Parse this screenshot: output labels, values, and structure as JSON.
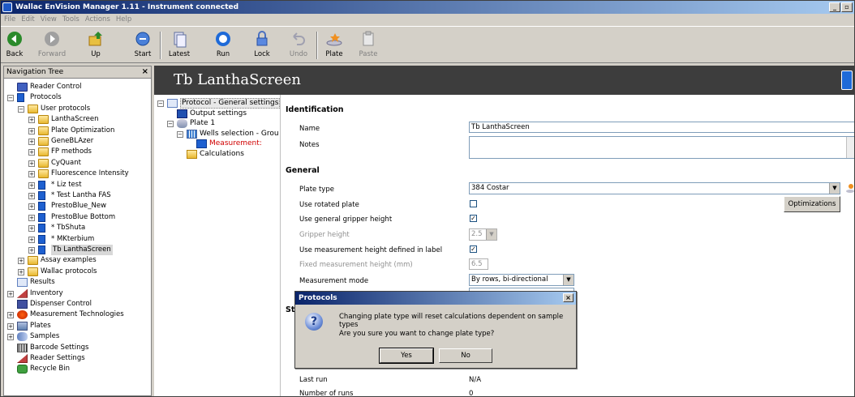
{
  "window": {
    "title": "Wallac EnVision Manager 1.11 - Instrument connected",
    "controls": [
      "_",
      "Ř",
      "×"
    ]
  },
  "menu": [
    "File",
    "Edit",
    "View",
    "Tools",
    "Actions",
    "Help"
  ],
  "toolbar": {
    "back": "Back",
    "forward": "Forward",
    "up": "Up",
    "start": "Start",
    "latest": "Latest",
    "run": "Run",
    "lock": "Lock",
    "undo": "Undo",
    "plate": "Plate",
    "paste": "Paste"
  },
  "nav": {
    "title": "Navigation Tree",
    "close": "×",
    "items": [
      {
        "label": "Reader Control"
      },
      {
        "label": "Protocols"
      },
      {
        "label": "User protocols"
      },
      {
        "label": "LanthaScreen"
      },
      {
        "label": "Plate Optimization"
      },
      {
        "label": "GeneBLAzer"
      },
      {
        "label": "FP methods"
      },
      {
        "label": "CyQuant"
      },
      {
        "label": "Fluorescence Intensity"
      },
      {
        "label": "* Liz test"
      },
      {
        "label": "* Test Lantha FAS"
      },
      {
        "label": "PrestoBlue_New"
      },
      {
        "label": "PrestoBlue Bottom"
      },
      {
        "label": "* TbShuta"
      },
      {
        "label": "* MKterbium"
      },
      {
        "label": "Tb LanthaScreen"
      },
      {
        "label": "Assay examples"
      },
      {
        "label": "Wallac protocols"
      },
      {
        "label": "Results"
      },
      {
        "label": "Inventory"
      },
      {
        "label": "Dispenser Control"
      },
      {
        "label": "Measurement Technologies"
      },
      {
        "label": "Plates"
      },
      {
        "label": "Samples"
      },
      {
        "label": "Barcode Settings"
      },
      {
        "label": "Reader Settings"
      },
      {
        "label": "Recycle Bin"
      }
    ]
  },
  "main": {
    "title": "Tb LanthaScreen",
    "protocol_tree": [
      {
        "label": "Protocol - General settings"
      },
      {
        "label": "Output settings"
      },
      {
        "label": "Plate 1"
      },
      {
        "label": "Wells selection - Grou"
      },
      {
        "label": "Measurement:"
      },
      {
        "label": "Calculations"
      }
    ],
    "identification": {
      "section": "Identification",
      "name_label": "Name",
      "name_value": "Tb LanthaScreen",
      "notes_label": "Notes"
    },
    "general": {
      "section": "General",
      "plate_type_label": "Plate type",
      "plate_type_value": "384 Costar",
      "rotated_label": "Use rotated plate",
      "gripper_label": "Use general gripper height",
      "gripper_height_label": "Gripper height",
      "gripper_height_value": "2.5",
      "meas_height_label": "Use measurement height defined in label",
      "fixed_height_label": "Fixed measurement height (mm)",
      "fixed_height_value": "6.5",
      "mode_label": "Measurement mode",
      "mode_value": "By rows, bi-directional",
      "optimizations_button": "Optimizations",
      "checkmark": "✓"
    },
    "status": {
      "section_fragment": "St",
      "last_run_label": "Last run",
      "last_run_value": "N/A",
      "runs_label": "Number of runs",
      "runs_value": "0"
    }
  },
  "dialog": {
    "title": "Protocols",
    "close": "×",
    "icon_glyph": "?",
    "message1": "Changing plate type will reset calculations dependent on sample types",
    "message2": "Are you sure you want to change plate type?",
    "yes": "Yes",
    "no": "No"
  },
  "colors": {
    "accent": "#0a246a",
    "header_bg": "#3d3d3d",
    "selected_meas": "#d00000"
  }
}
